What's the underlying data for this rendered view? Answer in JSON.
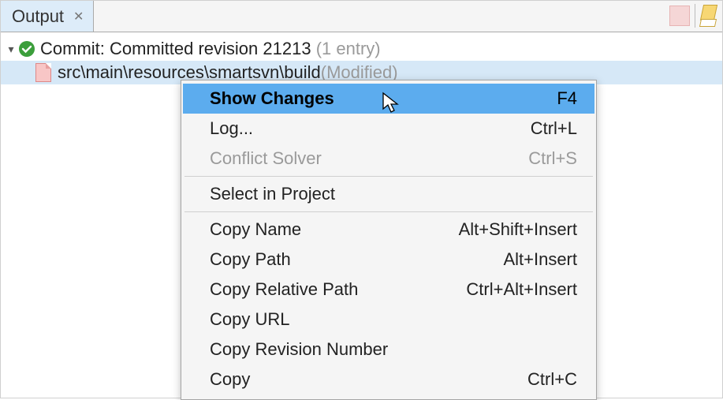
{
  "tab": {
    "label": "Output"
  },
  "tree": {
    "commit_prefix": "Commit: ",
    "commit_text": "Committed revision 21213",
    "commit_suffix": " (1 entry)",
    "file_path": "src\\main\\resources\\smartsvn\\build ",
    "file_status": "(Modified)"
  },
  "menu": {
    "items": [
      {
        "label": "Show Changes",
        "shortcut": "F4",
        "highlight": true
      },
      {
        "label": "Log...",
        "shortcut": "Ctrl+L"
      },
      {
        "label": "Conflict Solver",
        "shortcut": "Ctrl+S",
        "disabled": true
      },
      {
        "sep": true
      },
      {
        "label": "Select in Project",
        "shortcut": ""
      },
      {
        "sep": true
      },
      {
        "label": "Copy Name",
        "shortcut": "Alt+Shift+Insert"
      },
      {
        "label": "Copy Path",
        "shortcut": "Alt+Insert"
      },
      {
        "label": "Copy Relative Path",
        "shortcut": "Ctrl+Alt+Insert"
      },
      {
        "label": "Copy URL",
        "shortcut": ""
      },
      {
        "label": "Copy Revision Number",
        "shortcut": ""
      },
      {
        "label": "Copy",
        "shortcut": "Ctrl+C"
      }
    ]
  }
}
